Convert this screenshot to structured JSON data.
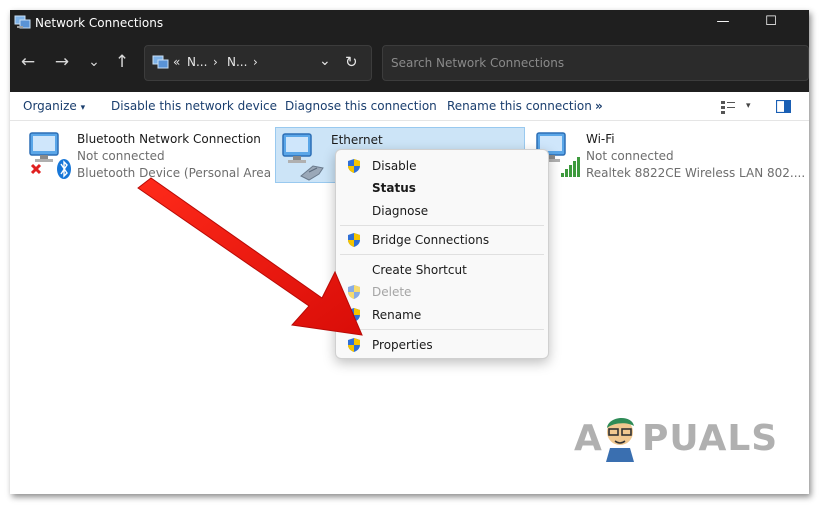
{
  "window": {
    "title": "Network Connections",
    "minimize_glyph": "—",
    "maximize_glyph": "☐"
  },
  "address_bar": {
    "back_glyph": "←",
    "forward_glyph": "→",
    "recent_glyph": "⌄",
    "up_glyph": "↑",
    "path_overflow": "«",
    "path_segments": [
      "N...",
      "N..."
    ],
    "path_sep": "›",
    "dropdown_glyph": "⌄",
    "refresh_glyph": "↻",
    "search_placeholder": "Search Network Connections"
  },
  "command_bar": {
    "organize_label": "Organize",
    "organize_caret": "▾",
    "disable_label": "Disable this network device",
    "diagnose_label": "Diagnose this connection",
    "rename_label": "Rename this connection",
    "more_glyph": "»",
    "view_caret": "▾"
  },
  "connections": [
    {
      "name": "Bluetooth Network Connection",
      "status": "Not connected",
      "device": "Bluetooth Device (Personal Area ..."
    },
    {
      "name": "Ethernet",
      "status": "",
      "device": ""
    },
    {
      "name": "Wi-Fi",
      "status": "Not connected",
      "device": "Realtek 8822CE Wireless LAN 802...."
    }
  ],
  "context_menu": {
    "items": [
      {
        "label": "Disable",
        "shield": true,
        "style": "normal"
      },
      {
        "label": "Status",
        "shield": false,
        "style": "bold"
      },
      {
        "label": "Diagnose",
        "shield": false,
        "style": "normal"
      },
      {
        "label": "Bridge Connections",
        "shield": true,
        "style": "normal"
      },
      {
        "label": "Create Shortcut",
        "shield": false,
        "style": "normal"
      },
      {
        "label": "Delete",
        "shield": true,
        "style": "disabled"
      },
      {
        "label": "Rename",
        "shield": true,
        "style": "normal"
      },
      {
        "label": "Properties",
        "shield": true,
        "style": "normal"
      }
    ]
  },
  "watermark": {
    "left": "A",
    "right": "PUALS"
  },
  "colors": {
    "titlebar_bg": "#1f1f1f",
    "selection_bg": "#cce4f7",
    "command_text": "#1a3e6e",
    "arrow_red": "#e8140e",
    "shield_blue": "#2f6fd6",
    "shield_yellow": "#f5c400"
  }
}
